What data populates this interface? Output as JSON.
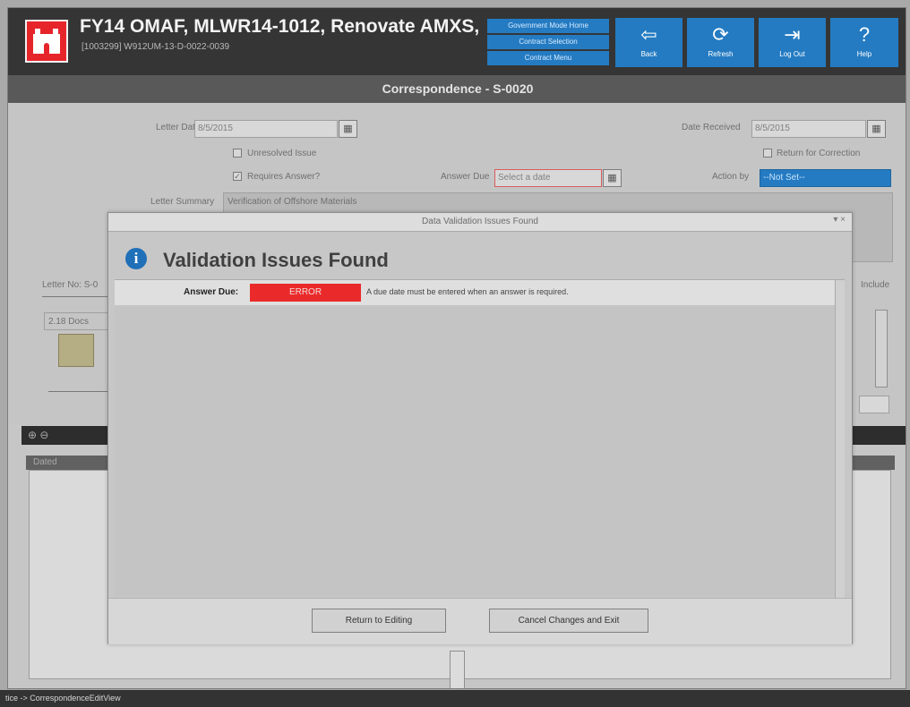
{
  "header": {
    "title": "FY14 OMAF, MLWR14-1012, Renovate AMXS,",
    "subtitle": "[1003299] W912UM-13-D-0022-0039",
    "nav_links": [
      "Government Mode Home",
      "Contract Selection",
      "Contract Menu"
    ],
    "tiles": [
      {
        "label": "Back",
        "icon": "left-arrow-icon",
        "glyph": "⇦"
      },
      {
        "label": "Refresh",
        "icon": "refresh-icon",
        "glyph": "⟳"
      },
      {
        "label": "Log Out",
        "icon": "log-out-icon",
        "glyph": "⇥"
      },
      {
        "label": "Help",
        "icon": "help-icon",
        "glyph": "?"
      }
    ]
  },
  "page": {
    "title": "Correspondence - S-0020"
  },
  "form": {
    "letter_dated_label": "Letter Dated",
    "letter_dated_value": "8/5/2015",
    "date_received_label": "Date Received",
    "date_received_value": "8/5/2015",
    "unresolved_issue_label": "Unresolved Issue",
    "return_for_correction_label": "Return for Correction",
    "requires_answer_label": "Requires Answer?",
    "answer_due_label": "Answer Due",
    "answer_due_placeholder": "Select a date",
    "action_by_label": "Action by",
    "action_by_value": "--Not Set--",
    "letter_summary_label": "Letter Summary",
    "letter_summary_value": "Verification of Offshore Materials",
    "letter_no_label": "Letter No: S-0",
    "docs_label": "2.18 Docs",
    "include_label": "Include",
    "lower_column": "Dated",
    "status_path": "tice -> CorrespondenceEditView"
  },
  "dialog": {
    "window_title": "Data Validation Issues Found",
    "heading": "Validation Issues Found",
    "issues": [
      {
        "field": "Answer Due:",
        "severity": "ERROR",
        "message": "A due date must be entered when an answer is required."
      }
    ],
    "buttons": {
      "return": "Return to Editing",
      "cancel": "Cancel Changes and Exit"
    }
  },
  "colors": {
    "accent": "#247bc2",
    "error": "#ea2a2a",
    "header": "#353535"
  }
}
